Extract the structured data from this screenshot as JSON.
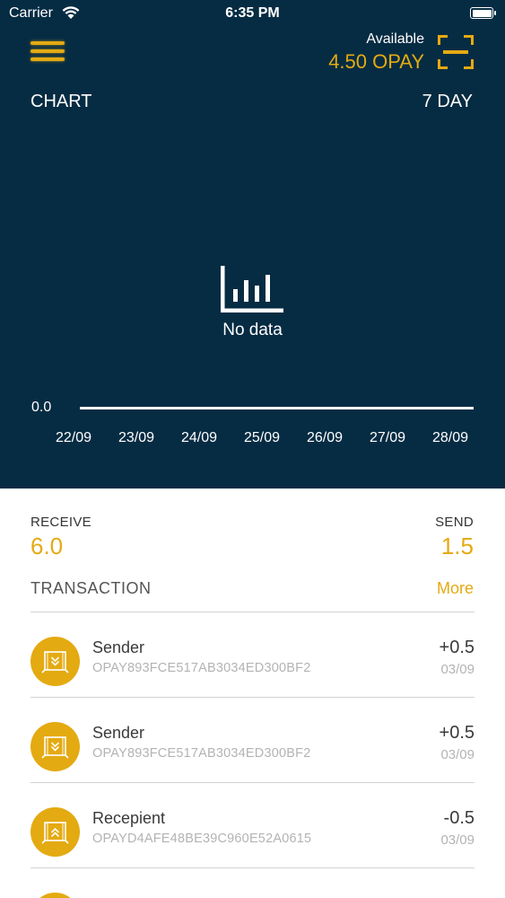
{
  "status_bar": {
    "carrier": "Carrier",
    "time": "6:35 PM"
  },
  "header": {
    "available_label": "Available",
    "available_amount": "4.50 OPAY"
  },
  "chart": {
    "label": "CHART",
    "range": "7 DAY",
    "no_data_text": "No data"
  },
  "chart_data": {
    "type": "line",
    "categories": [
      "22/09",
      "23/09",
      "24/09",
      "25/09",
      "26/09",
      "27/09",
      "28/09"
    ],
    "series": [],
    "y_ticks": [
      "0.0"
    ],
    "note_text": "No data"
  },
  "summary": {
    "receive_label": "RECEIVE",
    "receive_value": "6.0",
    "send_label": "SEND",
    "send_value": "1.5"
  },
  "transactions": {
    "title": "TRANSACTION",
    "more_label": "More",
    "items": [
      {
        "name": "Sender",
        "address": "OPAY893FCE517AB3034ED300BF2",
        "amount": "+0.5",
        "date": "03/09",
        "direction": "in"
      },
      {
        "name": "Sender",
        "address": "OPAY893FCE517AB3034ED300BF2",
        "amount": "+0.5",
        "date": "03/09",
        "direction": "in"
      },
      {
        "name": "Recepient",
        "address": "OPAYD4AFE48BE39C960E52A0615",
        "amount": "-0.5",
        "date": "03/09",
        "direction": "out"
      }
    ]
  },
  "colors": {
    "header_bg": "#062c43",
    "accent": "#e4aa12",
    "text_dark": "#3a3a3a",
    "text_muted": "#b3b3b3"
  }
}
